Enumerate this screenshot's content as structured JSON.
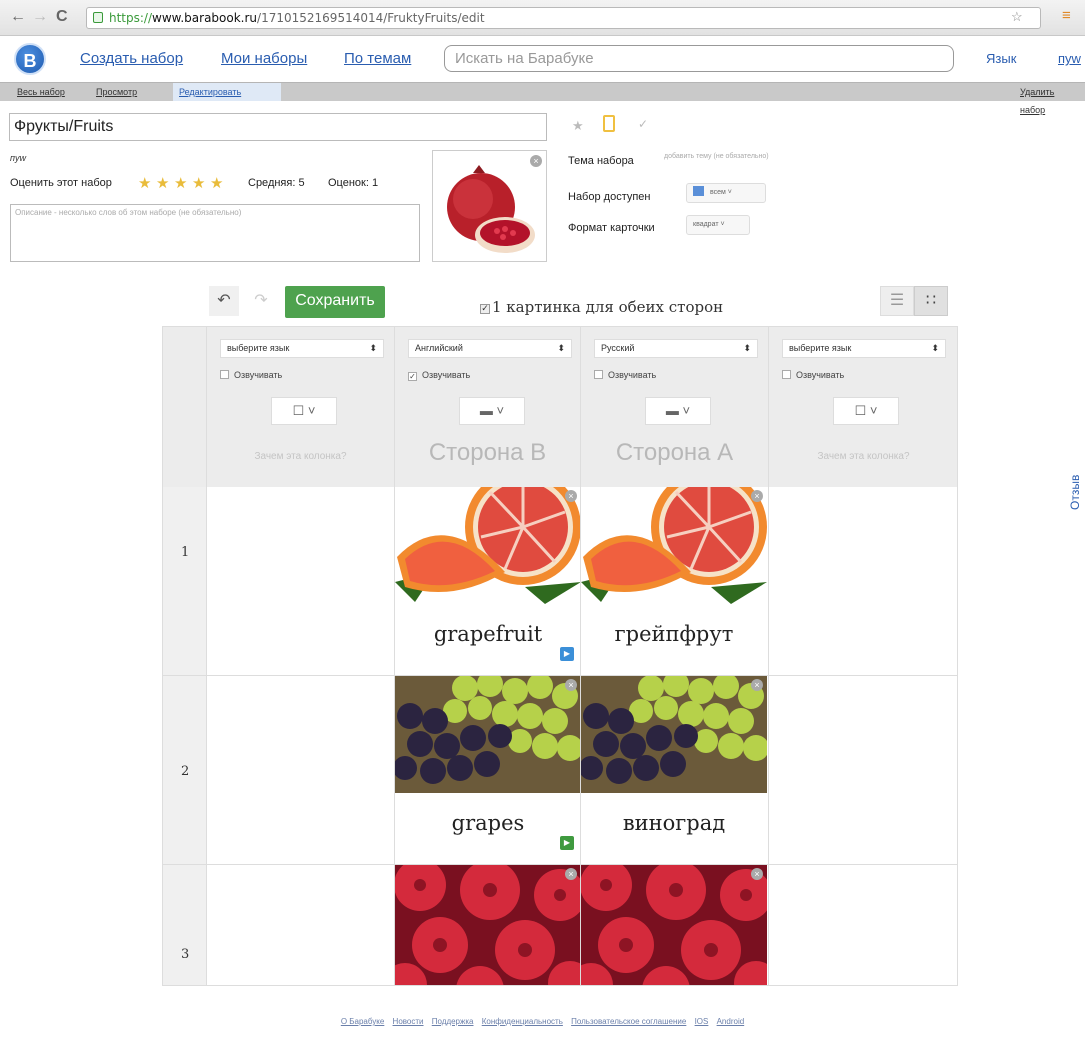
{
  "browser": {
    "url_scheme": "https://",
    "url_domain": "www.barabook.ru",
    "url_path": "/1710152169514014/FruktyFruits/edit"
  },
  "site": {
    "logo_letter": "B",
    "nav": {
      "create": "Создать набор",
      "my_sets": "Мои наборы",
      "by_topic": "По темам"
    },
    "search_placeholder": "Искать на Барабуке",
    "language": "Язык",
    "user": "пуw"
  },
  "tabs": {
    "whole_set": "Весь набор",
    "view": "Просмотр",
    "edit": "Редактировать",
    "delete": "Удалить набор"
  },
  "set": {
    "title": "Фрукты/Fruits",
    "author": "пуw",
    "rate_label": "Оценить этот набор",
    "rating_stars": 5,
    "average": "Средняя: 5",
    "votes": "Оценок: 1",
    "description_placeholder": "Описание - несколько слов об этом наборе (не обязательно)"
  },
  "settings": {
    "topic_label": "Тема набора",
    "topic_value": "добавить тему (не обязательно)",
    "access_label": "Набор доступен",
    "access_value": "всем",
    "format_label": "Формат карточки",
    "format_value": "квадрат"
  },
  "editor": {
    "save": "Сохранить",
    "one_picture": "1 картинка для обеих сторон",
    "one_picture_checked": true
  },
  "columns": [
    {
      "language": "выберите язык",
      "speak": "Озвучивать",
      "speak_checked": false,
      "caption": "Зачем эта колонка?",
      "kind": "why"
    },
    {
      "language": "Английский",
      "speak": "Озвучивать",
      "speak_checked": true,
      "caption": "Сторона B",
      "kind": "side"
    },
    {
      "language": "Русский",
      "speak": "Озвучивать",
      "speak_checked": false,
      "caption": "Сторона A",
      "kind": "side"
    },
    {
      "language": "выберите язык",
      "speak": "Озвучивать",
      "speak_checked": false,
      "caption": "Зачем эта колонка?",
      "kind": "why"
    }
  ],
  "rows": [
    {
      "num": "1",
      "side_b": "grapefruit",
      "side_a": "грейпфрут",
      "image": "grapefruit",
      "play_color": "#3b8fd8"
    },
    {
      "num": "2",
      "side_b": "grapes",
      "side_a": "виноград",
      "image": "grapes",
      "play_color": "#3f9a3f"
    },
    {
      "num": "3",
      "side_b": "",
      "side_a": "",
      "image": "raspberries",
      "play_color": ""
    }
  ],
  "feedback": "Отзыв",
  "footer": [
    "О Барабуке",
    "Новости",
    "Поддержка",
    "Конфиденциальность",
    "Пользовательское соглашение",
    "IOS",
    "Android"
  ],
  "colors": {
    "link": "#2a5db0",
    "save": "#4ea24e",
    "star": "#e9bc3b"
  },
  "icons": [
    "back-icon",
    "forward-icon",
    "reload-icon",
    "lock-icon",
    "bookmark-star-icon",
    "menu-icon",
    "star-icon",
    "card-icon",
    "check-icon",
    "undo-icon",
    "redo-icon",
    "list-view-icon",
    "grid-view-icon",
    "play-icon",
    "close-icon"
  ]
}
